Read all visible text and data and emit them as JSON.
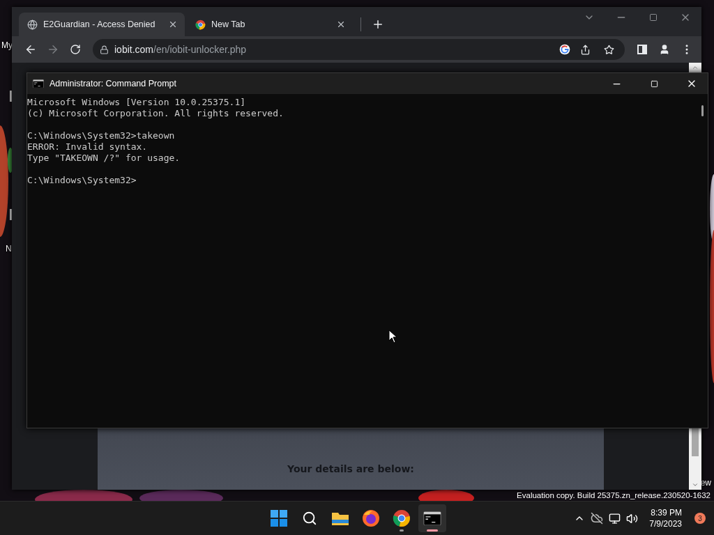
{
  "desktop": {
    "icon_labels": [
      "My",
      "N",
      "ew"
    ],
    "evaluation_notice": "Evaluation copy. Build 25375.zn_release.230520-1632"
  },
  "browser": {
    "tabs": [
      {
        "title": "E2Guardian - Access Denied",
        "selected": true
      },
      {
        "title": "New Tab",
        "selected": false
      }
    ],
    "address": {
      "domain": "iobit.com",
      "path": "/en/iobit-unlocker.php"
    },
    "page": {
      "heading": "Your details are below:"
    }
  },
  "console": {
    "title": "Administrator: Command Prompt",
    "blocks": [
      [
        "Microsoft Windows [Version 10.0.25375.1]",
        "(c) Microsoft Corporation. All rights reserved."
      ],
      [
        "C:\\Windows\\System32>takeown",
        "ERROR: Invalid syntax.",
        "Type \"TAKEOWN /?\" for usage."
      ],
      [
        "C:\\Windows\\System32>"
      ]
    ]
  },
  "taskbar": {
    "apps": [
      {
        "kind": "start",
        "running": false,
        "selected": false
      },
      {
        "kind": "search",
        "running": false,
        "selected": false
      },
      {
        "kind": "folder",
        "running": false,
        "selected": false
      },
      {
        "kind": "firefox",
        "running": false,
        "selected": false
      },
      {
        "kind": "chrome",
        "running": true,
        "selected": false
      },
      {
        "kind": "terminal",
        "running": true,
        "selected": true
      }
    ],
    "clock": {
      "time": "8:39 PM",
      "date": "7/9/2023"
    },
    "notifications": "3"
  }
}
